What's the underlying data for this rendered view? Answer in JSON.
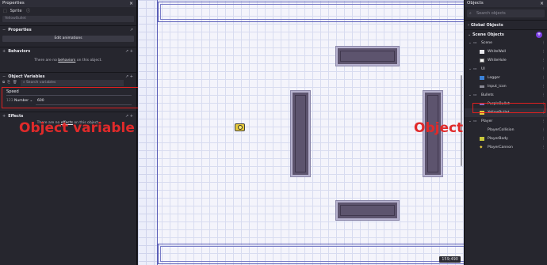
{
  "left_panel": {
    "title": "Properties",
    "close": "×",
    "object_kind": "Sprite",
    "object_name": "YellowBullet",
    "properties": {
      "label": "Properties",
      "toggle": "−",
      "edit_animations": "Edit animations"
    },
    "behaviors": {
      "label": "Behaviors",
      "toggle": "+",
      "empty_text_pre": "There are no ",
      "empty_link": "behaviors",
      "empty_text_post": " on this object."
    },
    "variables": {
      "label": "Object Variables",
      "toggle": "−",
      "search_placeholder": "Search variables",
      "var_name": "Speed",
      "var_type": "Number",
      "var_value": "600"
    },
    "effects": {
      "label": "Effects",
      "toggle": "+",
      "empty_text_pre": "There are no ",
      "empty_link": "effects",
      "empty_text_post": " on this object."
    }
  },
  "annotations": {
    "left": "Object variable",
    "right": "Object"
  },
  "canvas": {
    "coordinates": "159;490"
  },
  "right_panel": {
    "title": "Objects",
    "close": "×",
    "search_placeholder": "Search objects",
    "global_objects": "Global Objects",
    "scene_objects": "Scene Objects",
    "groups": [
      {
        "name": "Scene",
        "items": [
          "WhiteWall",
          "WhiteHole"
        ]
      },
      {
        "name": "UI",
        "items": [
          "Logger",
          "Input_icon"
        ]
      },
      {
        "name": "Bullets",
        "items": [
          "PurpleBullet",
          "YellowBullet"
        ]
      },
      {
        "name": "Player",
        "items": [
          "PlayerCollision",
          "PlayerBody",
          "PlayerCannon"
        ]
      }
    ]
  },
  "colors": {
    "accent": "#7b3fe4",
    "highlight": "#e02020",
    "wall": "#5d546e",
    "bullet": "#e6c93b"
  }
}
